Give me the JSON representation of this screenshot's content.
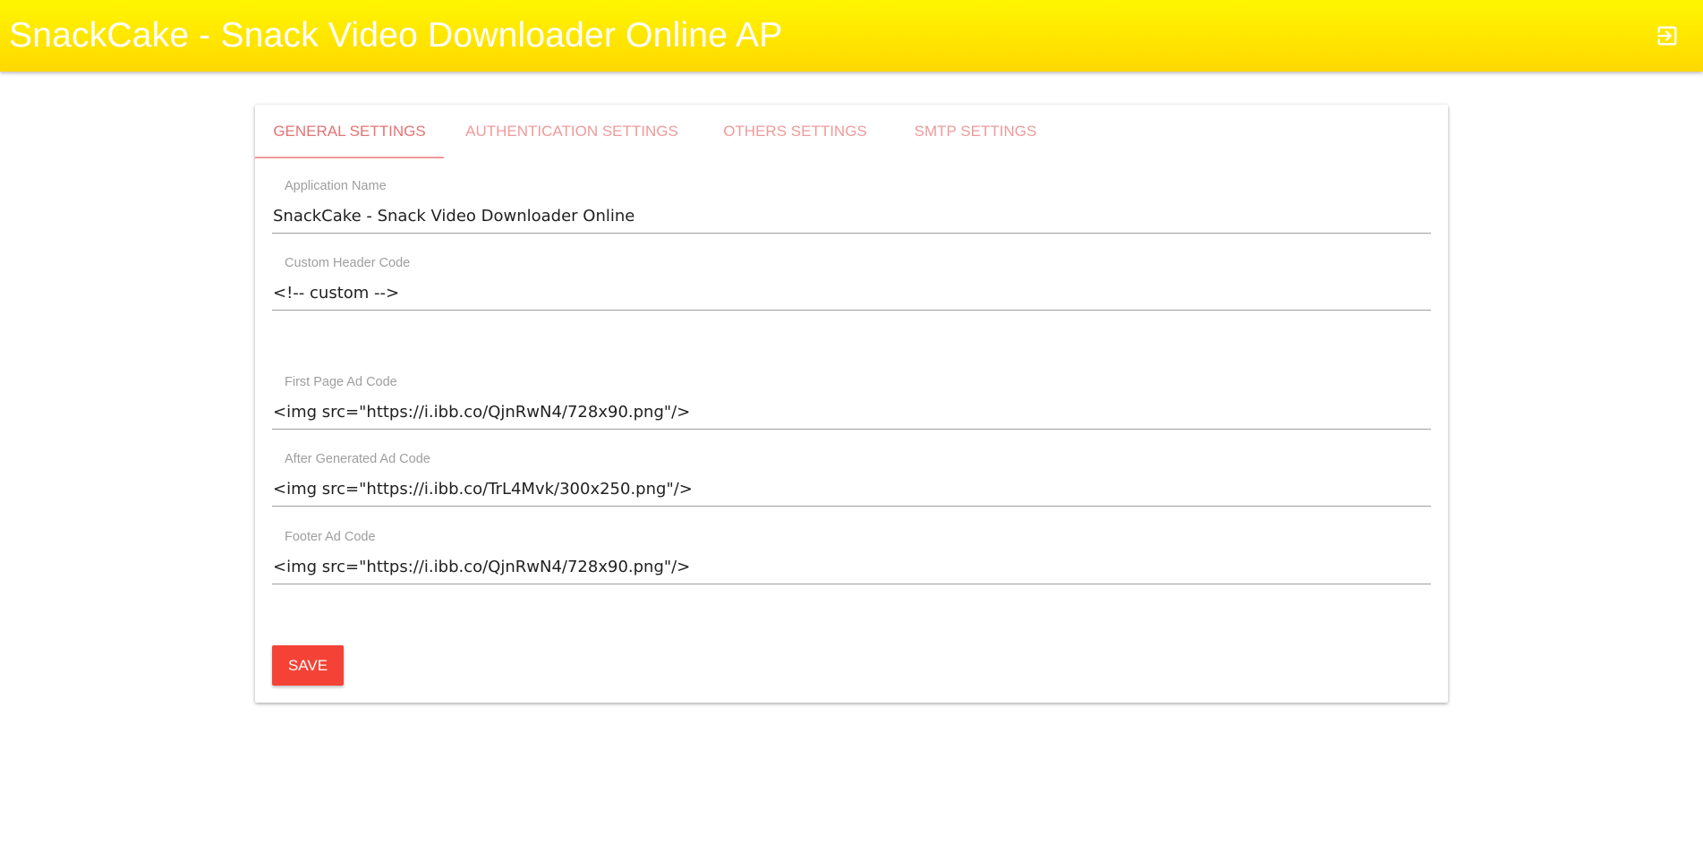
{
  "header": {
    "title": "SnackCake - Snack Video Downloader Online AP",
    "logout_icon": "logout-icon"
  },
  "tabs": [
    {
      "label": "GENERAL SETTINGS",
      "active": true
    },
    {
      "label": "AUTHENTICATION SETTINGS",
      "active": false
    },
    {
      "label": "OTHERS SETTINGS",
      "active": false
    },
    {
      "label": "SMTP SETTINGS",
      "active": false
    }
  ],
  "form": {
    "app_name": {
      "label": "Application Name",
      "value": "SnackCake - Snack Video Downloader Online"
    },
    "custom_header": {
      "label": "Custom Header Code",
      "value": "<!-- custom -->"
    },
    "first_page_ad": {
      "label": "First Page Ad Code",
      "value": "<img src=\"https://i.ibb.co/QjnRwN4/728x90.png\"/>"
    },
    "after_generated_ad": {
      "label": "After Generated Ad Code",
      "value": "<img src=\"https://i.ibb.co/TrL4Mvk/300x250.png\"/>"
    },
    "footer_ad": {
      "label": "Footer Ad Code",
      "value": "<img src=\"https://i.ibb.co/QjnRwN4/728x90.png\"/>"
    }
  },
  "actions": {
    "save_label": "SAVE"
  },
  "colors": {
    "header_gradient_top": "#fff600",
    "header_gradient_bottom": "#ffd800",
    "accent": "#f44336",
    "tab_text": "#ef9a9a"
  }
}
